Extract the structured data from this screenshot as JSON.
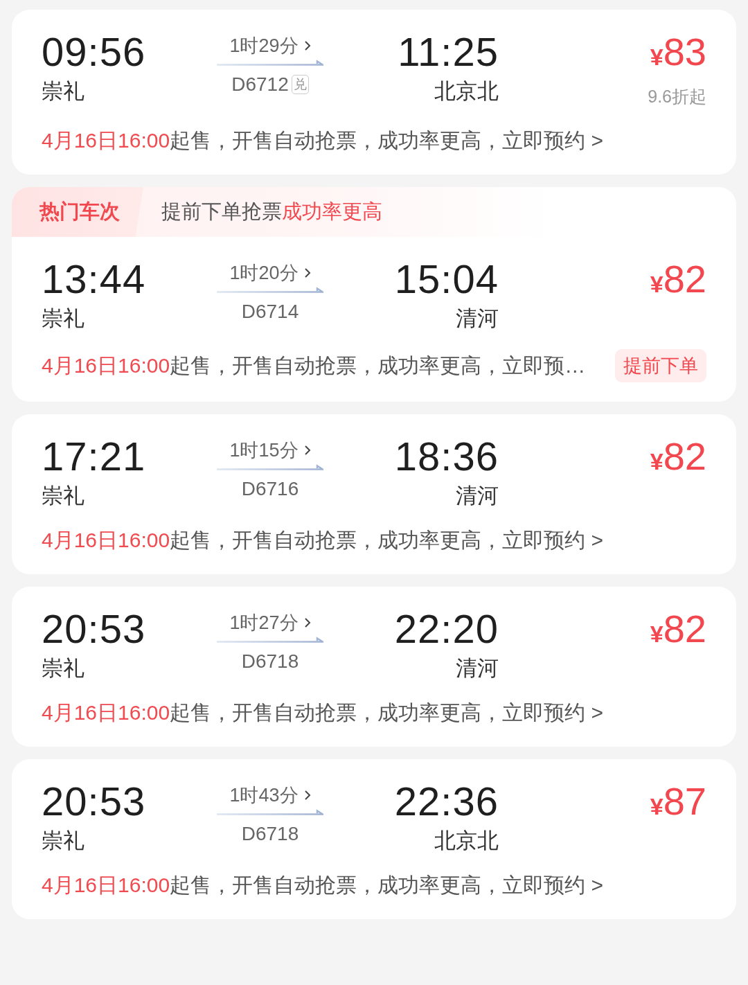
{
  "trains": [
    {
      "depart_time": "09:56",
      "depart_station": "崇礼",
      "duration": "1时29分",
      "train_no": "D6712",
      "badge": "兑",
      "arrive_time": "11:25",
      "arrive_station": "北京北",
      "currency": "¥",
      "price": "83",
      "discount": "9.6折起",
      "sale_time": "4月16日16:00",
      "note": "起售，开售自动抢票，成功率更高，立即预约 >"
    },
    {
      "banner": {
        "tag": "热门车次",
        "text": "提前下单抢票",
        "highlight": "成功率更高"
      },
      "depart_time": "13:44",
      "depart_station": "崇礼",
      "duration": "1时20分",
      "train_no": "D6714",
      "arrive_time": "15:04",
      "arrive_station": "清河",
      "currency": "¥",
      "price": "82",
      "sale_time": "4月16日16:00",
      "note": "起售，开售自动抢票，成功率更高，立即预…",
      "action": "提前下单"
    },
    {
      "depart_time": "17:21",
      "depart_station": "崇礼",
      "duration": "1时15分",
      "train_no": "D6716",
      "arrive_time": "18:36",
      "arrive_station": "清河",
      "currency": "¥",
      "price": "82",
      "sale_time": "4月16日16:00",
      "note": "起售，开售自动抢票，成功率更高，立即预约 >"
    },
    {
      "depart_time": "20:53",
      "depart_station": "崇礼",
      "duration": "1时27分",
      "train_no": "D6718",
      "arrive_time": "22:20",
      "arrive_station": "清河",
      "currency": "¥",
      "price": "82",
      "sale_time": "4月16日16:00",
      "note": "起售，开售自动抢票，成功率更高，立即预约 >"
    },
    {
      "depart_time": "20:53",
      "depart_station": "崇礼",
      "duration": "1时43分",
      "train_no": "D6718",
      "arrive_time": "22:36",
      "arrive_station": "北京北",
      "currency": "¥",
      "price": "87",
      "sale_time": "4月16日16:00",
      "note": "起售，开售自动抢票，成功率更高，立即预约 >"
    }
  ]
}
